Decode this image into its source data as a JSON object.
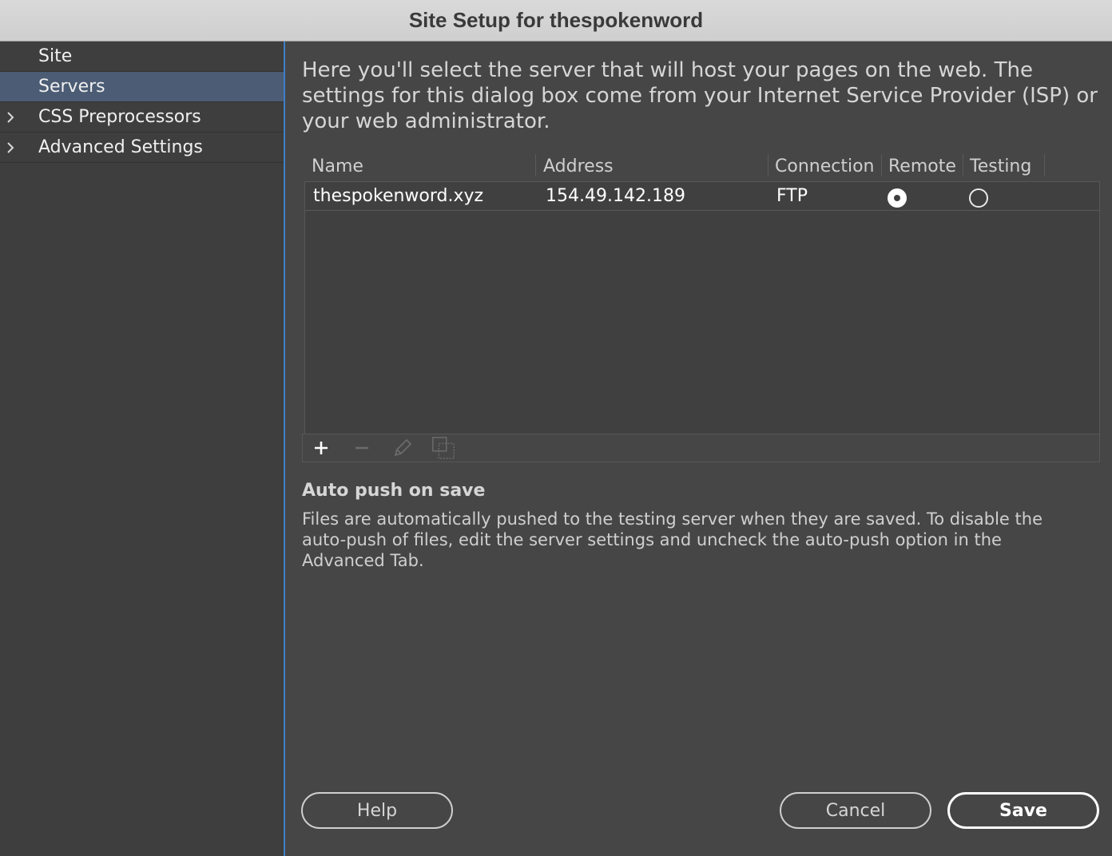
{
  "window": {
    "title": "Site Setup for thespokenword"
  },
  "sidebar": {
    "items": [
      {
        "label": "Site",
        "selected": false,
        "expandable": false
      },
      {
        "label": "Servers",
        "selected": true,
        "expandable": false
      },
      {
        "label": "CSS Preprocessors",
        "selected": false,
        "expandable": true
      },
      {
        "label": "Advanced Settings",
        "selected": false,
        "expandable": true
      }
    ]
  },
  "main": {
    "intro": "Here you'll select the server that will host your pages on the web. The settings for this dialog box come from your Internet Service Provider (ISP) or your web administrator.",
    "table": {
      "columns": [
        "Name",
        "Address",
        "Connection",
        "Remote",
        "Testing"
      ],
      "rows": [
        {
          "name": "thespokenword.xyz",
          "address": "154.49.142.189",
          "connection": "FTP",
          "remote": true,
          "testing": false
        }
      ]
    },
    "toolbar": {
      "icons": [
        "plus-icon",
        "minus-icon",
        "pencil-icon",
        "duplicate-icon"
      ]
    },
    "auto_push": {
      "title": "Auto push on save",
      "text": "Files are automatically pushed to the testing server when they are saved. To disable the auto-push of files, edit the server settings and uncheck the auto-push option in the Advanced Tab."
    }
  },
  "buttons": {
    "help": "Help",
    "cancel": "Cancel",
    "save": "Save"
  },
  "colors": {
    "accent": "#3f7fc8",
    "selection": "#4b5c74",
    "background": "#464646"
  }
}
